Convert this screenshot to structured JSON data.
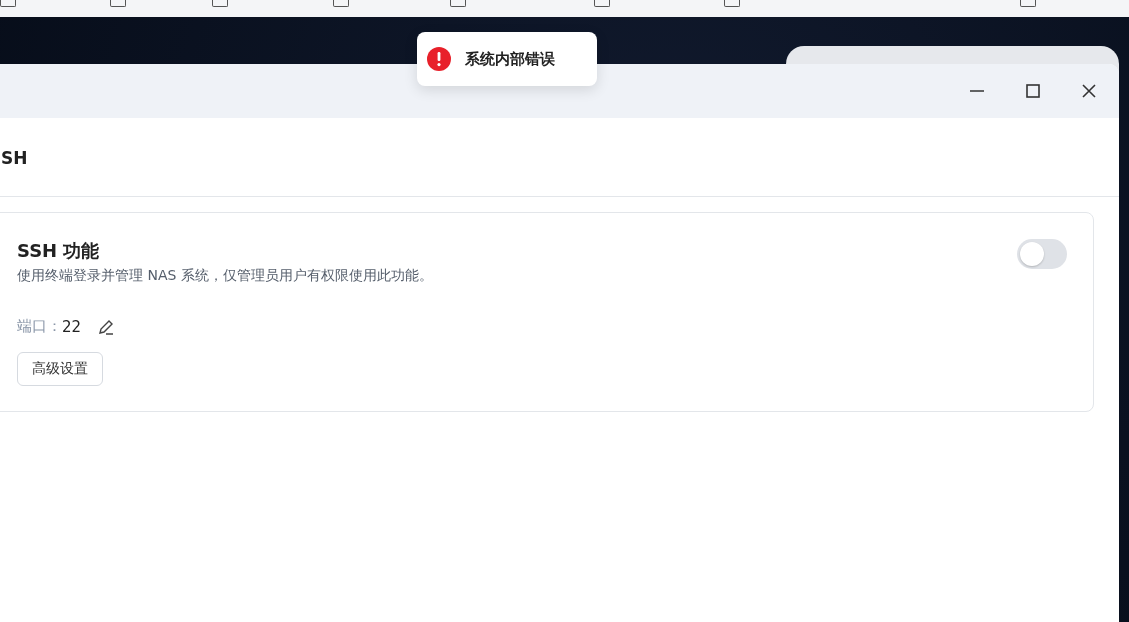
{
  "toast": {
    "kind": "error",
    "message": "系统内部错误"
  },
  "window": {
    "section_title": "SH"
  },
  "ssh": {
    "title": "SSH 功能",
    "description": "使用终端登录并管理 NAS 系统，仅管理员用户有权限使用此功能。",
    "on": false,
    "port_label": "端口：",
    "port": "22",
    "advanced_button": "高级设置"
  }
}
